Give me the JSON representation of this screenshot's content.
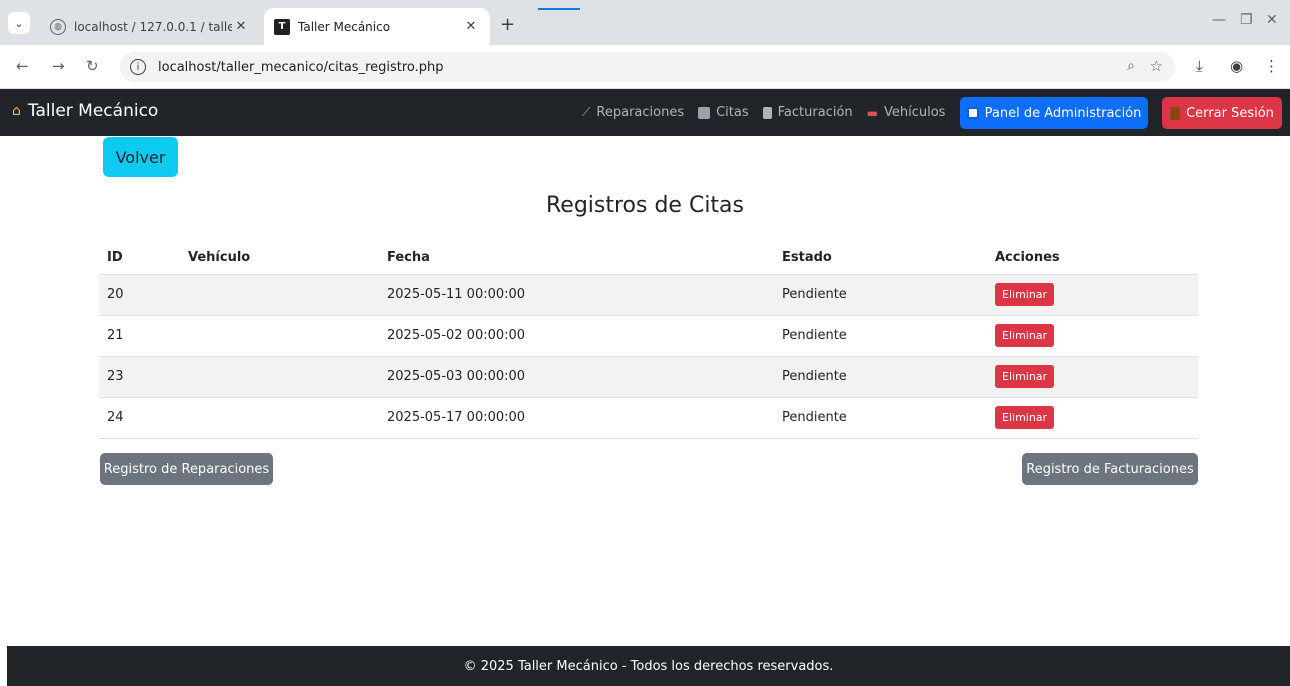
{
  "browser": {
    "tabs": [
      {
        "title": "localhost / 127.0.0.1 / taller_me",
        "favicon": "globe-icon"
      },
      {
        "title": "Taller Mecánico",
        "favicon": "app-favicon-icon"
      }
    ],
    "favicon_letter": "T",
    "url": "localhost/taller_mecanico/citas_registro.php"
  },
  "navbar": {
    "brand": "Taller Mecánico",
    "links": [
      {
        "label": "Reparaciones",
        "icon": "wrench-icon"
      },
      {
        "label": "Citas",
        "icon": "calendar-icon"
      },
      {
        "label": "Facturación",
        "icon": "receipt-icon"
      },
      {
        "label": "Vehículos",
        "icon": "car-icon"
      }
    ],
    "admin_label": "Panel de Administración",
    "logout_label": "Cerrar Sesión"
  },
  "page": {
    "back_label": "Volver",
    "title": "Registros de Citas"
  },
  "table": {
    "headers": [
      "ID",
      "Vehículo",
      "Fecha",
      "Estado",
      "Acciones"
    ],
    "rows": [
      {
        "id": "20",
        "vehiculo": "",
        "fecha": "2025-05-11 00:00:00",
        "estado": "Pendiente",
        "accion": "Eliminar"
      },
      {
        "id": "21",
        "vehiculo": "",
        "fecha": "2025-05-02 00:00:00",
        "estado": "Pendiente",
        "accion": "Eliminar"
      },
      {
        "id": "23",
        "vehiculo": "",
        "fecha": "2025-05-03 00:00:00",
        "estado": "Pendiente",
        "accion": "Eliminar"
      },
      {
        "id": "24",
        "vehiculo": "",
        "fecha": "2025-05-17 00:00:00",
        "estado": "Pendiente",
        "accion": "Eliminar"
      }
    ]
  },
  "actions": {
    "reparaciones_label": "Registro de Reparaciones",
    "facturaciones_label": "Registro de Facturaciones"
  },
  "footer": {
    "text": "© 2025 Taller Mecánico - Todos los derechos reservados."
  },
  "colors": {
    "navbar_bg": "#212529",
    "primary": "#0d6efd",
    "danger": "#dc3545",
    "info": "#0dcaf0",
    "secondary": "#6c757d"
  }
}
